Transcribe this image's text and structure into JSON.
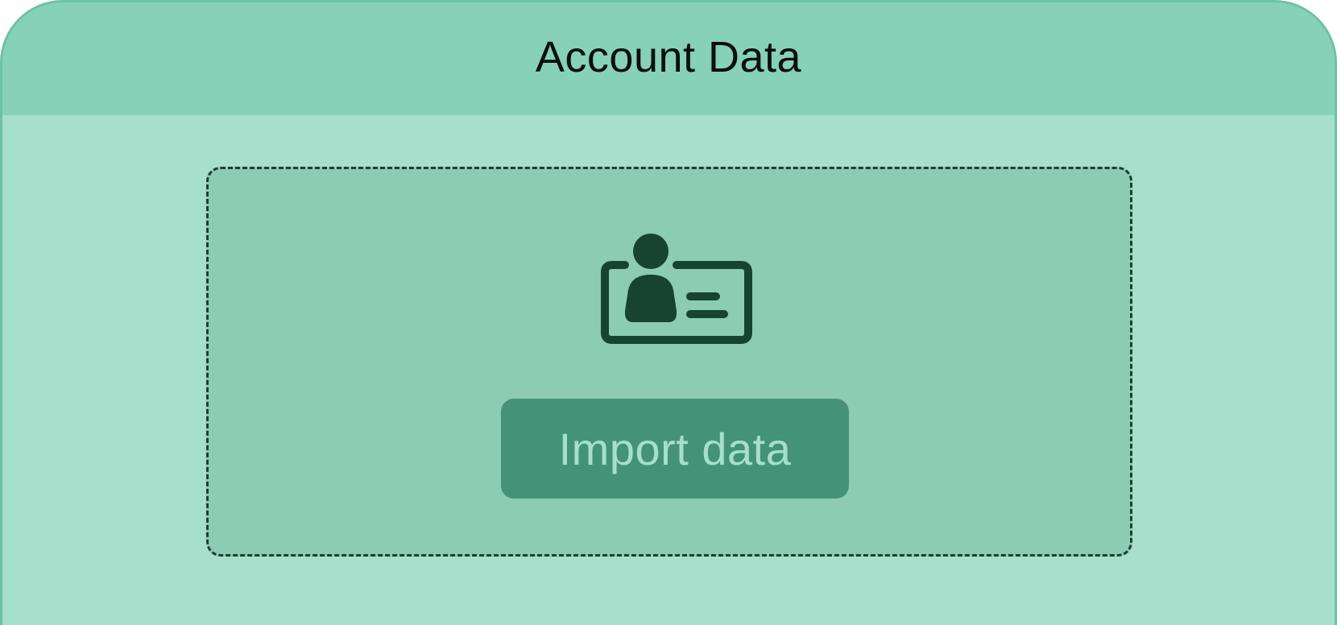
{
  "window": {
    "title": "Account Data"
  },
  "dropzone": {
    "icon": "id-card-icon",
    "button_label": "Import data"
  },
  "colors": {
    "window_background": "#a6dfcb",
    "titlebar_background": "#86d1b8",
    "dropzone_background": "#8ccbb4",
    "dropzone_border": "#1a3e32",
    "button_background": "#449379",
    "button_text": "#a6dfcb",
    "icon_color": "#174332"
  }
}
